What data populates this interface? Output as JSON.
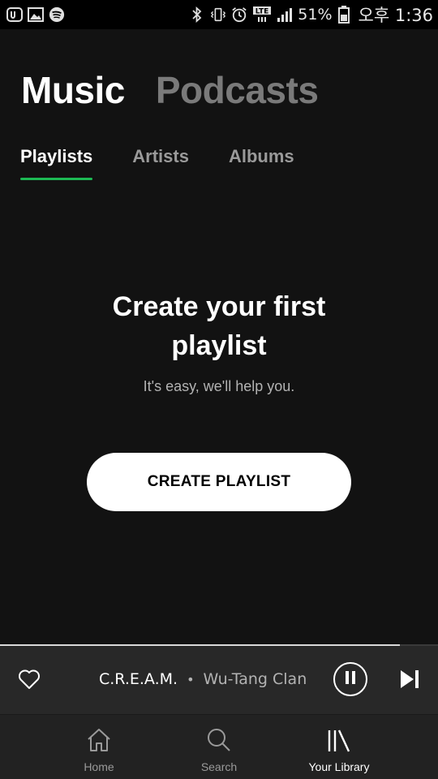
{
  "status_bar": {
    "battery_percent": "51%",
    "time": "오후 1:36",
    "network_label": "LTE",
    "icons": [
      "app-icon",
      "gallery-icon",
      "spotify-icon",
      "bluetooth-icon",
      "vibrate-icon",
      "alarm-icon",
      "lte-icon",
      "signal-icon",
      "battery-icon"
    ]
  },
  "top_tabs": {
    "music": "Music",
    "podcasts": "Podcasts",
    "active": "music"
  },
  "sub_tabs": {
    "playlists": "Playlists",
    "artists": "Artists",
    "albums": "Albums",
    "active": "playlists"
  },
  "empty_state": {
    "title": "Create your first playlist",
    "subtitle": "It's easy, we'll help you.",
    "button_label": "CREATE PLAYLIST"
  },
  "now_playing": {
    "track": "C.R.E.A.M.",
    "separator": "•",
    "artist": "Wu-Tang Clan",
    "progress": 0.913,
    "is_playing": true
  },
  "bottom_nav": {
    "items": [
      {
        "label": "Home",
        "icon": "home-icon"
      },
      {
        "label": "Search",
        "icon": "search-icon"
      },
      {
        "label": "Your Library",
        "icon": "library-icon"
      }
    ],
    "active_index": 2
  },
  "colors": {
    "background": "#121212",
    "accent_green": "#1db954",
    "now_playing_bg": "#282828",
    "nav_bg": "#222222"
  }
}
